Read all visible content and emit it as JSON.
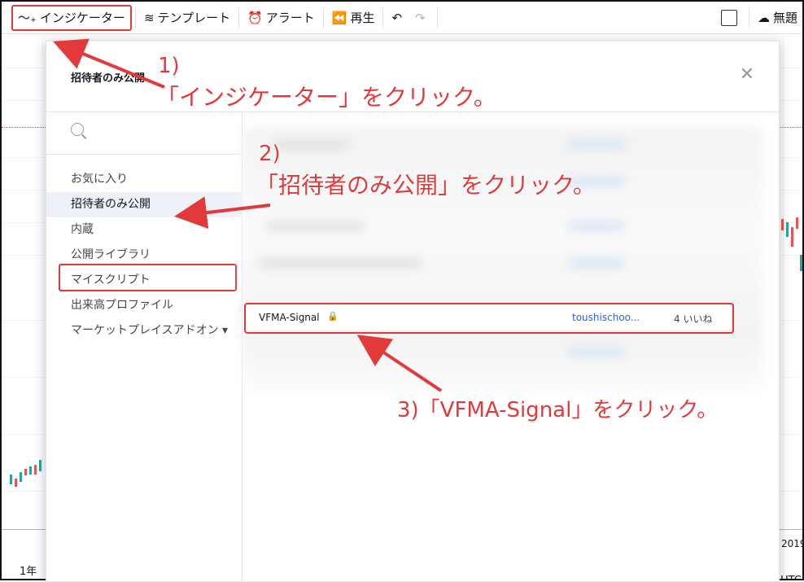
{
  "toolbar": {
    "indicators_label": "インジケーター",
    "templates_label": "テンプレート",
    "alerts_label": "アラート",
    "replay_label": "再生",
    "layout_label": "無題"
  },
  "chart": {
    "date_label": "2019",
    "timeframe_label": "1年",
    "timezone_label": ") (UTC"
  },
  "modal": {
    "title": "招待者のみ公開",
    "search_placeholder": "",
    "categories": [
      {
        "label": "お気に入り"
      },
      {
        "label": "招待者のみ公開"
      },
      {
        "label": "内蔵"
      },
      {
        "label": "公開ライブラリ"
      },
      {
        "label": "マイスクリプト"
      },
      {
        "label": "出来高プロファイル"
      },
      {
        "label": "マーケットプレイスアドオン ▾"
      }
    ],
    "result": {
      "name": "VFMA-Signal",
      "author": "toushischoo...",
      "likes": "4 いいね"
    }
  },
  "annotations": {
    "step1_num": "1)",
    "step1_text": "「インジケーター」をクリック。",
    "step2_num": "2)",
    "step2_text": "「招待者のみ公開」をクリック。",
    "step3_text": "3)「VFMA-Signal」をクリック。"
  },
  "colors": {
    "annotation_red": "#e23a3a",
    "link_blue": "#2962ff",
    "lock_green": "#26a69a"
  }
}
